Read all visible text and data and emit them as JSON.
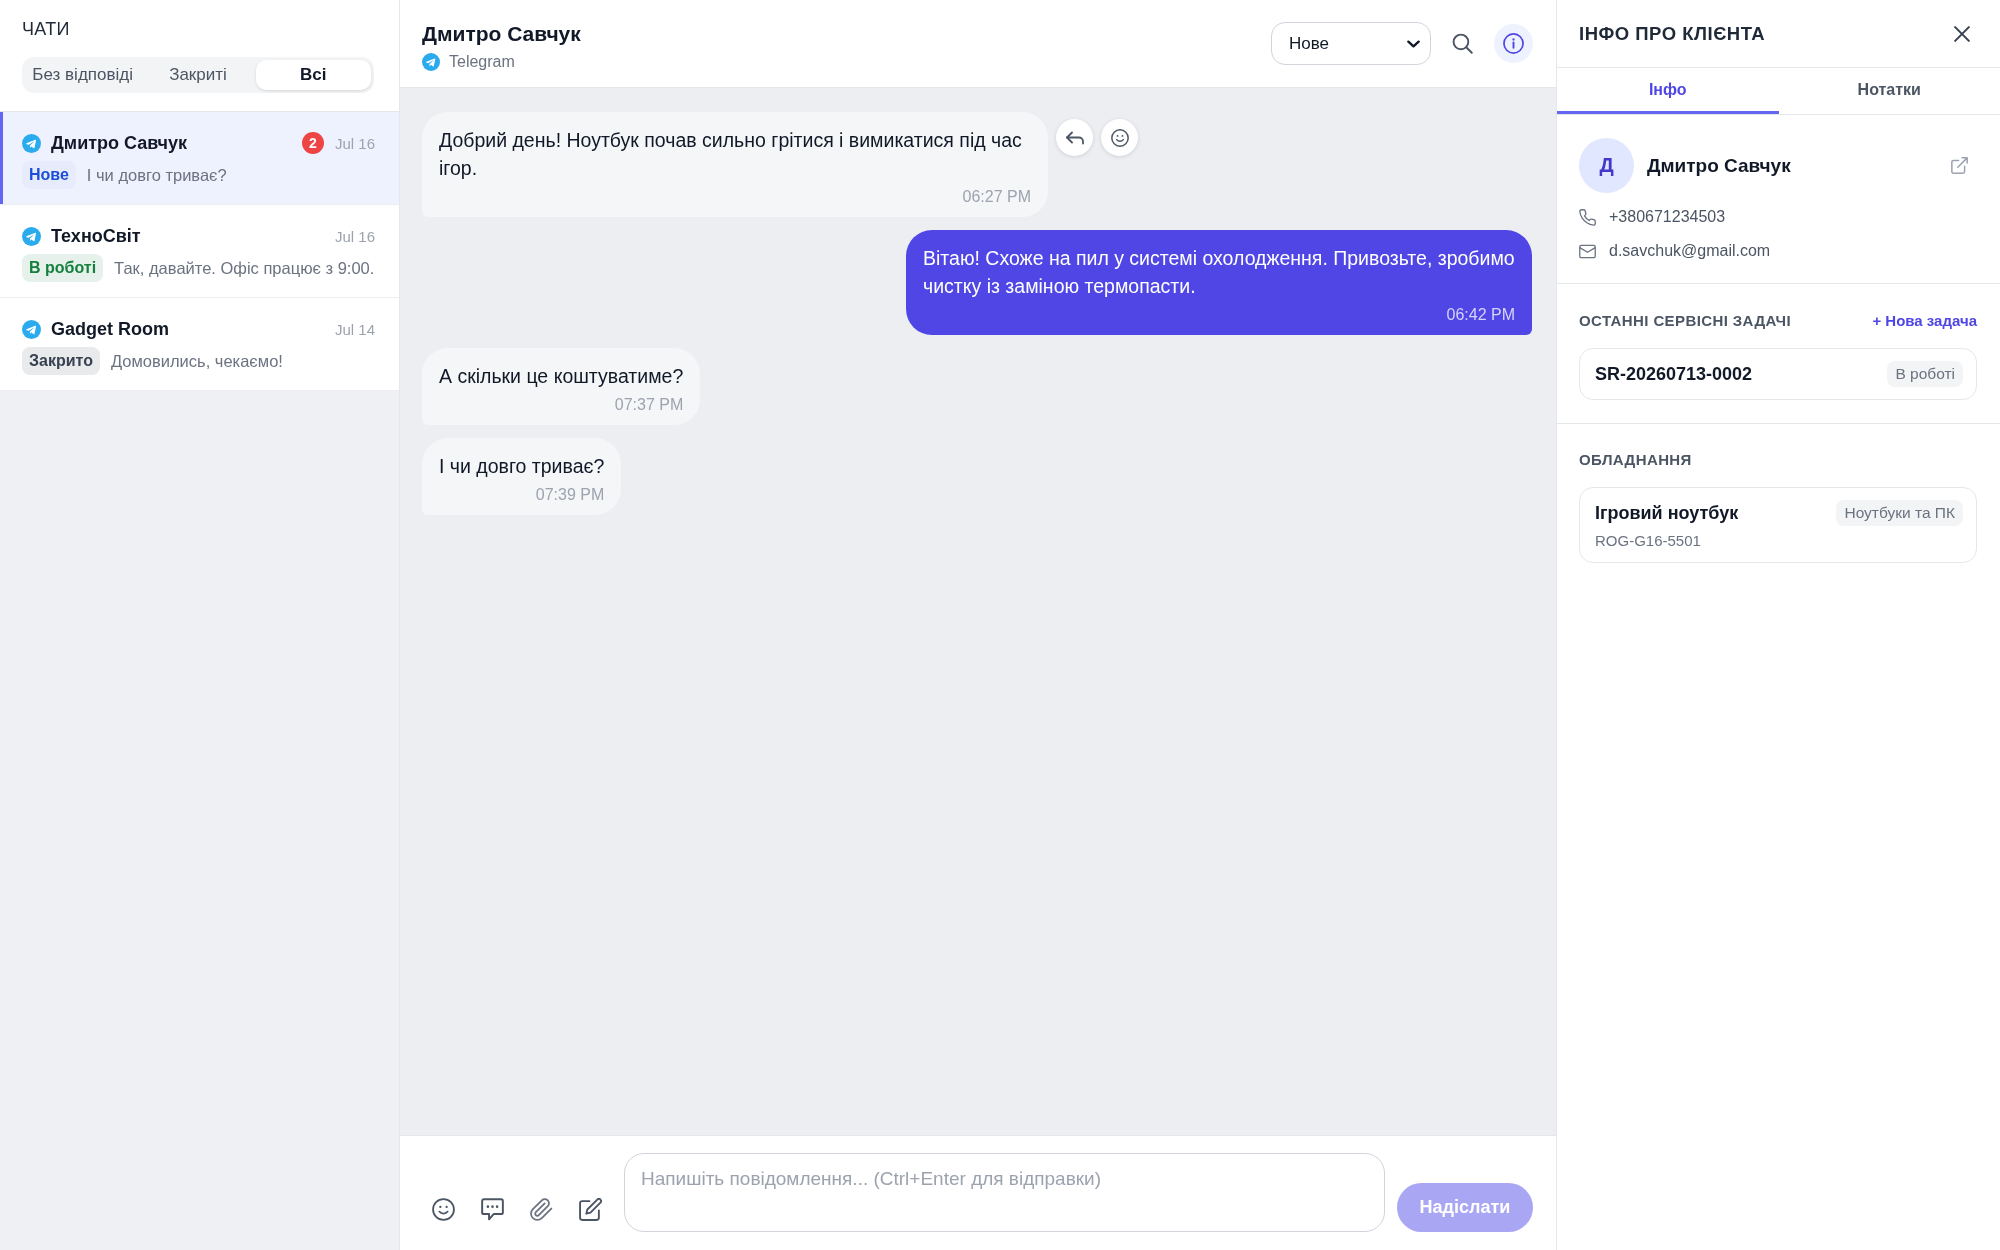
{
  "sidebar": {
    "title": "ЧАТИ",
    "filters": [
      {
        "label": "Без відповіді",
        "selected": false
      },
      {
        "label": "Закриті",
        "selected": false
      },
      {
        "label": "Всі",
        "selected": true
      }
    ],
    "chats": [
      {
        "name": "Дмитро Савчук",
        "unread": "2",
        "date": "Jul 16",
        "status": {
          "label": "Нове",
          "color": "#1d4ed8"
        },
        "preview": "І чи довго триває?",
        "selected": true
      },
      {
        "name": "ТехноСвіт",
        "date": "Jul 16",
        "status": {
          "label": "В роботі",
          "color": "#15803d"
        },
        "preview": "Так, давайте. Офіс працює з 9:00.",
        "selected": false
      },
      {
        "name": "Gadget Room",
        "date": "Jul 14",
        "status": {
          "label": "Закрито",
          "color": "#374151"
        },
        "preview": "Домовились, чекаємо!",
        "selected": false
      }
    ]
  },
  "conversation": {
    "title": "Дмитро Савчук",
    "channel": "Telegram",
    "status_select": {
      "value": "Нове"
    },
    "info_button": {
      "selected": true
    },
    "messages": [
      {
        "kind": "incoming",
        "text": "Добрий день! Ноутбук почав сильно грітися і вимикатися під час ігор.",
        "time": "06:27 PM",
        "hovered": true
      },
      {
        "kind": "outgoing",
        "text": "Вітаю! Схоже на пил у системі охолодження. Привозьте, зробимо чистку із заміною термопасти.",
        "time": "06:42 PM",
        "hovered": false
      },
      {
        "kind": "incoming",
        "text": "А скільки це коштуватиме?",
        "time": "07:37 PM",
        "hovered": false
      },
      {
        "kind": "incoming",
        "text": "І чи довго триває?",
        "time": "07:39 PM",
        "hovered": false
      }
    ],
    "composer": {
      "placeholder": "Напишіть повідомлення... (Ctrl+Enter для відправки)",
      "send_label": "Надіслати",
      "send_disabled": true
    }
  },
  "client_panel": {
    "title": "ІНФО ПРО КЛІЄНТА",
    "tabs": [
      {
        "label": "Інфо",
        "selected": true
      },
      {
        "label": "Нотатки",
        "selected": false
      }
    ],
    "client": {
      "initial": "Д",
      "name": "Дмитро Савчук",
      "phone": "+380671234503",
      "email": "d.savchuk@gmail.com"
    },
    "tasks": {
      "title": "ОСТАННІ СЕРВІСНІ ЗАДАЧІ",
      "action": "+ Нова задача",
      "items": [
        {
          "id": "SR-20260713-0002",
          "status": "В роботі"
        }
      ]
    },
    "equipment": {
      "title": "ОБЛАДНАННЯ",
      "items": [
        {
          "name": "Ігровий ноутбук",
          "category": "Ноутбуки та ПК",
          "serial": "ROG-G16-5501"
        }
      ]
    }
  }
}
